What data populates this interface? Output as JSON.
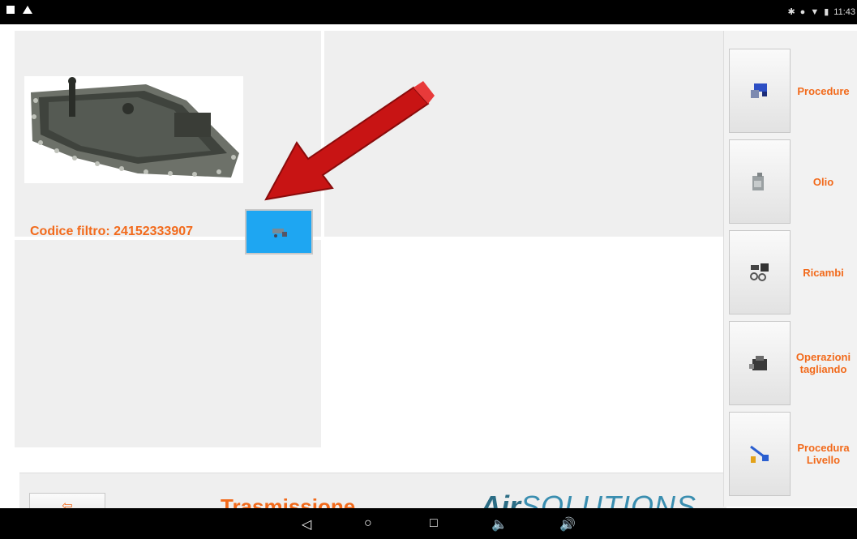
{
  "status_bar": {
    "time": "11:43"
  },
  "product": {
    "code_label": "Codice filtro:",
    "code_value": "24152333907"
  },
  "footer": {
    "back_label": "⇦",
    "title": "Trasmissione",
    "logo_air": "Air",
    "logo_solutions": "SOLUTIONS"
  },
  "sidebar": {
    "items": [
      {
        "label": "Procedure",
        "icon": "procedure-icon"
      },
      {
        "label": "Olio",
        "icon": "oil-can-icon"
      },
      {
        "label": "Ricambi",
        "icon": "spare-parts-icon"
      },
      {
        "label": "Operazioni tagliando",
        "icon": "service-operations-icon"
      },
      {
        "label": "Procedura Livello",
        "icon": "level-dipstick-icon"
      }
    ]
  },
  "nav_bar": {
    "back": "◁",
    "home": "○",
    "recents": "□",
    "vol_down": "🔈",
    "vol_up": "🔊"
  },
  "colors": {
    "accent": "#f26a1b",
    "button_blue": "#1ea6f2",
    "arrow_red": "#c81414"
  }
}
